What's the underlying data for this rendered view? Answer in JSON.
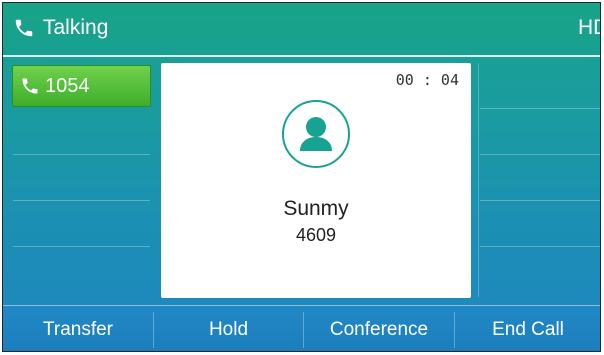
{
  "title_bar": {
    "status": "Talking",
    "call_icon": "phone-handset-icon",
    "badge": "HD"
  },
  "lines": {
    "active": {
      "label": "1054",
      "icon": "phone-handset-icon",
      "color": "#4cbf30"
    }
  },
  "call": {
    "timer": "00 : 04",
    "contact_name": "Sunmy",
    "contact_number": "4609",
    "avatar_icon": "person-avatar-icon",
    "accent_color": "#17a391"
  },
  "softkeys": [
    {
      "label": "Transfer"
    },
    {
      "label": "Hold"
    },
    {
      "label": "Conference"
    },
    {
      "label": "End Call"
    }
  ]
}
